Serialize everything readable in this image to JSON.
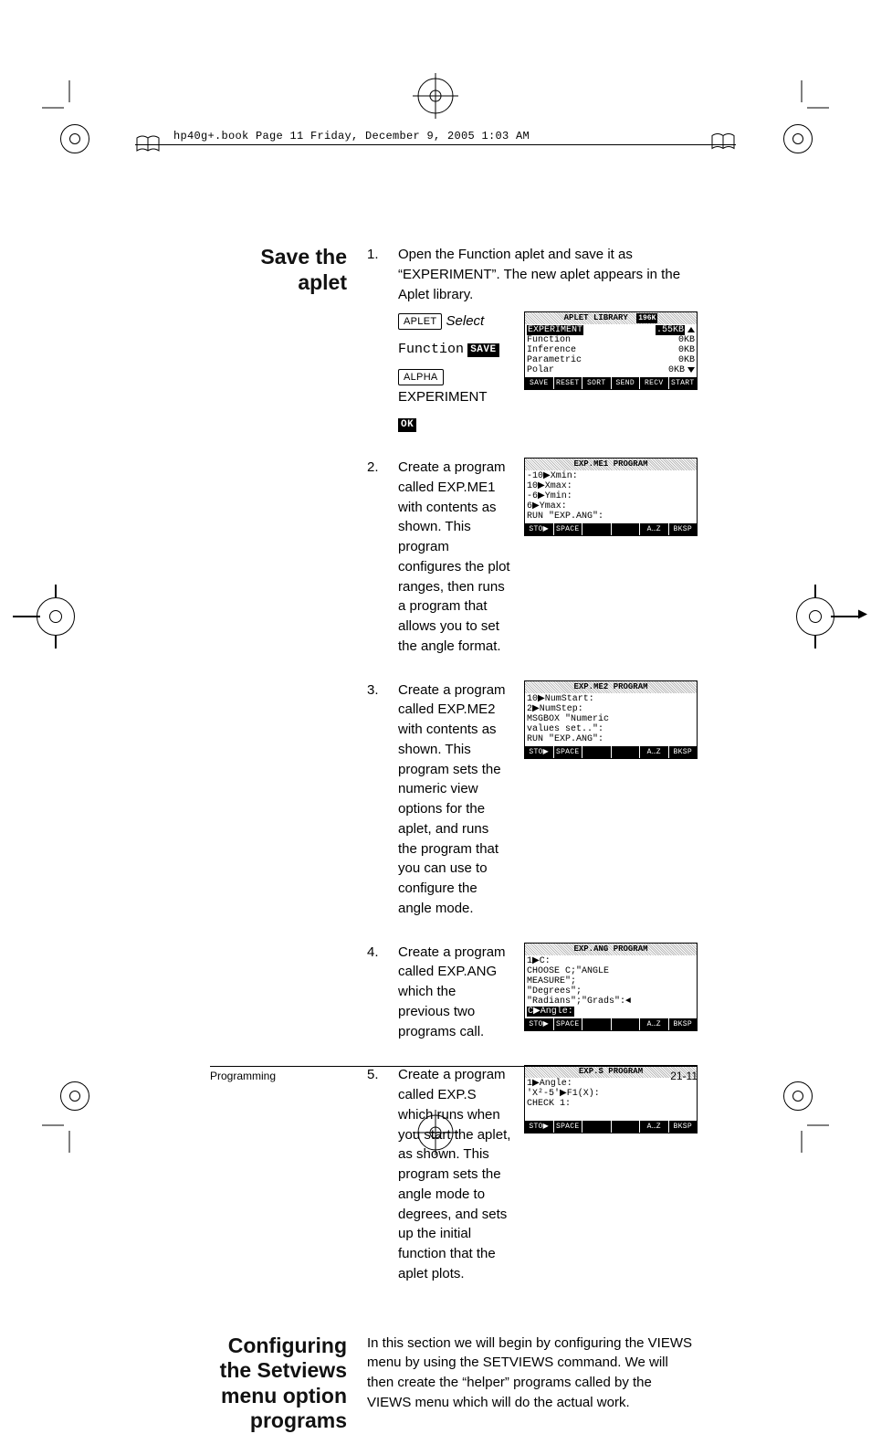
{
  "header": {
    "book_info": "hp40g+.book  Page 11  Friday, December 9, 2005  1:03 AM"
  },
  "sections": {
    "save_aplet": {
      "title": "Save the aplet"
    },
    "configure": {
      "title": "Configuring the Setviews menu option programs",
      "body": "In this section we will begin by configuring the VIEWS menu by using the SETVIEWS command. We will then create the “helper” programs called by the VIEWS menu which will do the actual work."
    }
  },
  "steps": [
    {
      "num": "1.",
      "text": "Open the Function aplet and save it as “EXPERIMENT”. The new aplet appears in the Aplet library."
    },
    {
      "num": "2.",
      "text": "Create a program called EXP.ME1 with contents as shown. This program configures the plot ranges, then runs a program that allows you to set the angle format."
    },
    {
      "num": "3.",
      "text": "Create a program called EXP.ME2 with contents as shown. This program sets the numeric view options for the aplet, and runs the program that you can use to configure the angle mode."
    },
    {
      "num": "4.",
      "text": "Create a program called EXP.ANG which the previous two programs call."
    },
    {
      "num": "5.",
      "text": "Create a program called EXP.S which runs when you start the aplet, as shown. This program sets the angle mode to degrees, and sets up the initial function that the aplet plots."
    }
  ],
  "keystrokes": {
    "aplet": "APLET",
    "select": "Select",
    "function": "Function",
    "save": "SAVE",
    "alpha": "ALPHA",
    "experiment": "EXPERIMENT",
    "ok": "OK"
  },
  "screens": {
    "aplet_library": {
      "title": "APLET LIBRARY",
      "mem": "196K",
      "rows": [
        {
          "name": "EXPERIMENT",
          "size": ".55KB",
          "sel": true
        },
        {
          "name": "Function",
          "size": "0KB"
        },
        {
          "name": "Inference",
          "size": "0KB"
        },
        {
          "name": "Parametric",
          "size": "0KB"
        },
        {
          "name": "Polar",
          "size": "0KB"
        }
      ],
      "keys": [
        "SAVE",
        "RESET",
        "SORT",
        "SEND",
        "RECV",
        "START"
      ]
    },
    "me1": {
      "title": "EXP.ME1 PROGRAM",
      "lines": [
        "-10▶Xmin:",
        "10▶Xmax:",
        "-6▶Ymin:",
        "6▶Ymax:",
        "RUN \"EXP.ANG\":"
      ],
      "keys": [
        "STO▶",
        "SPACE",
        "",
        "",
        "A…Z",
        "BKSP"
      ]
    },
    "me2": {
      "title": "EXP.ME2 PROGRAM",
      "lines": [
        "10▶NumStart:",
        "2▶NumStep:",
        "MSGBOX \"Numeric",
        "values set..\":",
        "RUN \"EXP.ANG\":"
      ],
      "keys": [
        "STO▶",
        "SPACE",
        "",
        "",
        "A…Z",
        "BKSP"
      ]
    },
    "ang": {
      "title": "EXP.ANG PROGRAM",
      "lines": [
        "1▶C:",
        "CHOOSE C;\"ANGLE",
        "MEASURE\";",
        "\"Degrees\";",
        "\"Radians\";\"Grads\":◄",
        "C▶Angle:"
      ],
      "keys": [
        "STO▶",
        "SPACE",
        "",
        "",
        "A…Z",
        "BKSP"
      ]
    },
    "s": {
      "title": "EXP.S PROGRAM",
      "lines": [
        "1▶Angle:",
        "'X²-5'▶F1(X):",
        "CHECK 1:",
        " ",
        " "
      ],
      "keys": [
        "STO▶",
        "SPACE",
        "",
        "",
        "A…Z",
        "BKSP"
      ]
    }
  },
  "footer": {
    "left": "Programming",
    "right": "21-11"
  }
}
